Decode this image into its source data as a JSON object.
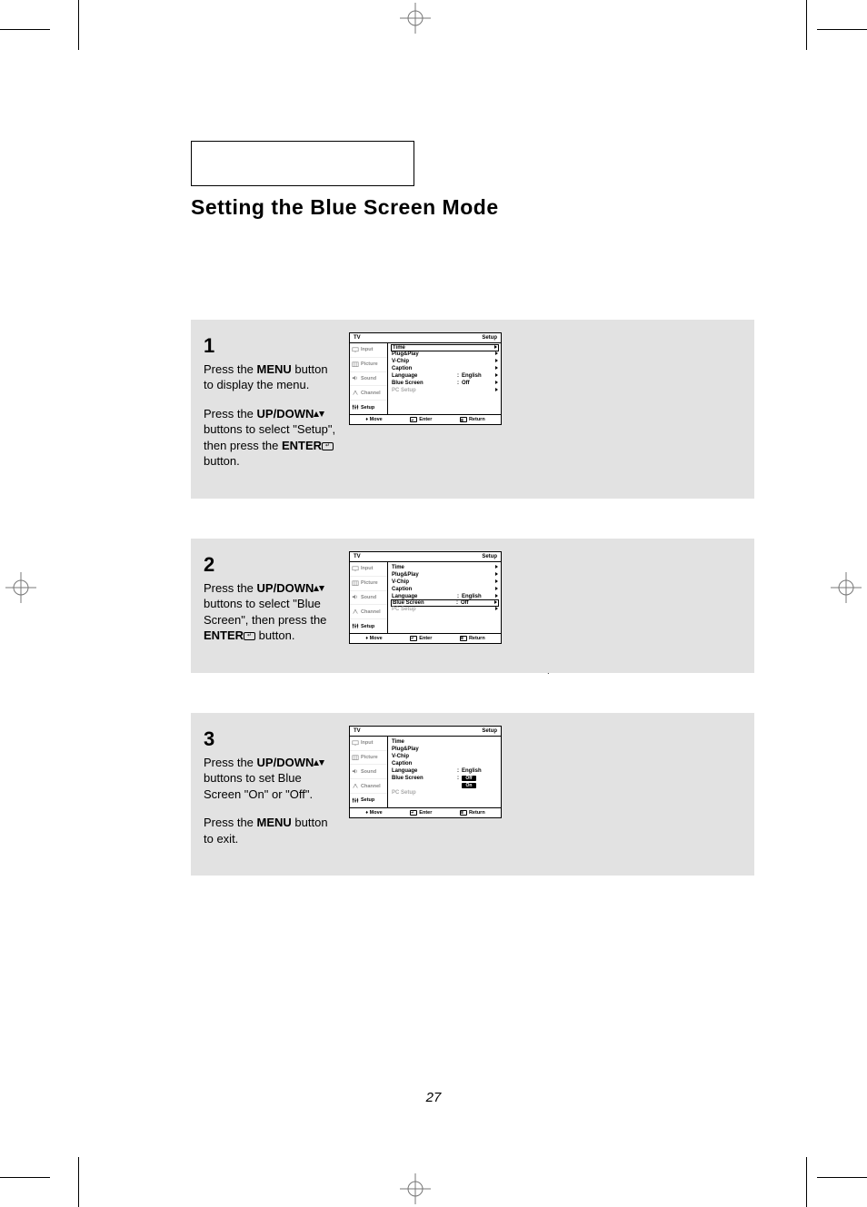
{
  "title": "Setting the Blue Screen Mode",
  "page_number": "27",
  "steps": [
    {
      "num": "1",
      "paras": [
        [
          {
            "t": "Press the "
          },
          {
            "b": "MENU"
          },
          {
            "t": " button to display the menu."
          }
        ],
        [
          {
            "t": "Press the "
          },
          {
            "b": "UP/DOWN"
          },
          {
            "i": "updown"
          },
          {
            "t": " buttons to select \"Setup\", then press the "
          },
          {
            "b": "ENTER"
          },
          {
            "i": "enter"
          },
          {
            "t": " button."
          }
        ]
      ],
      "menu": {
        "header_left": "TV",
        "header_right": "Setup",
        "rows": [
          {
            "label": "Time",
            "boxed": true,
            "arrow": true
          },
          {
            "label": "Plug&Play",
            "arrow": true
          },
          {
            "label": "V-Chip",
            "arrow": true
          },
          {
            "label": "Caption",
            "arrow": true
          },
          {
            "label": "Language",
            "sep": ":",
            "val": "English",
            "arrow": true
          },
          {
            "label": "Blue Screen",
            "sep": ":",
            "val": "Off",
            "arrow": true
          },
          {
            "label": "PC Setup",
            "dim": true,
            "arrow": true
          }
        ]
      }
    },
    {
      "num": "2",
      "paras": [
        [
          {
            "t": "Press the "
          },
          {
            "b": "UP/DOWN"
          },
          {
            "i": "updown"
          },
          {
            "t": " buttons to select \"Blue Screen\", then press the "
          },
          {
            "b": "ENTER"
          },
          {
            "i": "enter"
          },
          {
            "t": " button."
          }
        ]
      ],
      "menu": {
        "header_left": "TV",
        "header_right": "Setup",
        "rows": [
          {
            "label": "Time",
            "arrow": true
          },
          {
            "label": "Plug&Play",
            "arrow": true
          },
          {
            "label": "V-Chip",
            "arrow": true
          },
          {
            "label": "Caption",
            "arrow": true
          },
          {
            "label": "Language",
            "sep": ":",
            "val": "English",
            "arrow": true
          },
          {
            "label": "Blue Screen",
            "sep": ":",
            "val": "Off",
            "boxed": true,
            "arrow": true
          },
          {
            "label": "PC Setup",
            "dim": true,
            "arrow": true
          }
        ]
      }
    },
    {
      "num": "3",
      "paras": [
        [
          {
            "t": "Press the "
          },
          {
            "b": "UP/DOWN"
          },
          {
            "i": "updown"
          },
          {
            "t": " buttons to set Blue Screen \"On\" or \"Off\"."
          }
        ],
        [
          {
            "t": "Press the "
          },
          {
            "b": "MENU"
          },
          {
            "t": " button to exit."
          }
        ]
      ],
      "menu": {
        "header_left": "TV",
        "header_right": "Setup",
        "rows": [
          {
            "label": "Time"
          },
          {
            "label": "Plug&Play"
          },
          {
            "label": "V-Chip"
          },
          {
            "label": "Caption"
          },
          {
            "label": "Language",
            "sep": ":",
            "val": "English"
          },
          {
            "label": "Blue Screen",
            "sep": ":",
            "pill": "Off"
          },
          {
            "label": "",
            "pill": "On",
            "pillonly": true
          },
          {
            "label": "PC Setup",
            "dim": true
          }
        ]
      }
    }
  ],
  "side_items": [
    {
      "label": "Input"
    },
    {
      "label": "Picture"
    },
    {
      "label": "Sound"
    },
    {
      "label": "Channel"
    },
    {
      "label": "Setup",
      "active": true
    }
  ],
  "footer": {
    "move": "Move",
    "enter": "Enter",
    "ret": "Return"
  }
}
